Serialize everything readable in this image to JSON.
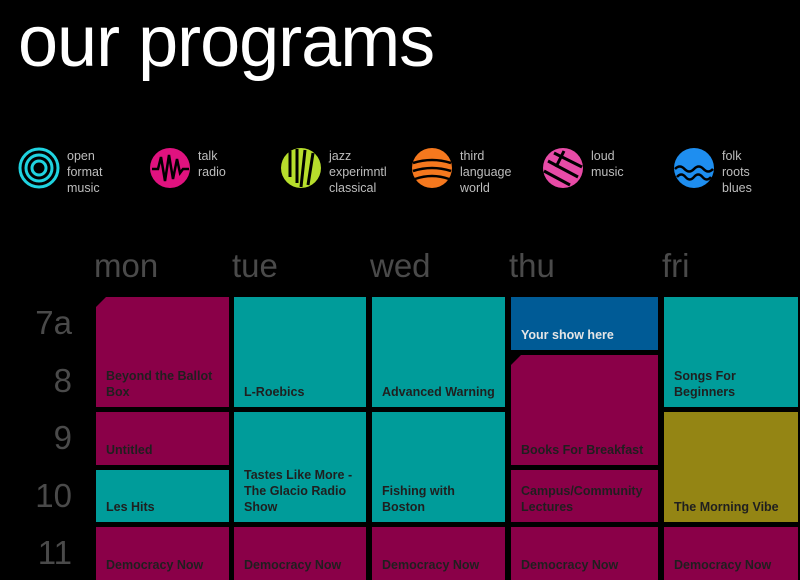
{
  "page": {
    "title": "our programs"
  },
  "legend": [
    {
      "icon": "target-icon",
      "color": "#1fd3e0",
      "lines": [
        "open",
        "format",
        "music"
      ]
    },
    {
      "icon": "waveform-icon",
      "color": "#e0127f",
      "lines": [
        "talk",
        "radio"
      ]
    },
    {
      "icon": "slashes-icon",
      "color": "#b7de2c",
      "lines": [
        "jazz",
        "experimntl",
        "classical"
      ]
    },
    {
      "icon": "curves-icon",
      "color": "#f5781e",
      "lines": [
        "third",
        "language",
        "world"
      ]
    },
    {
      "icon": "lines-icon",
      "color": "#e84ba7",
      "lines": [
        "loud",
        "music"
      ]
    },
    {
      "icon": "waves-icon",
      "color": "#1e8ef0",
      "lines": [
        "folk",
        "roots",
        "blues"
      ]
    }
  ],
  "days": [
    "mon",
    "tue",
    "wed",
    "thu",
    "fri"
  ],
  "hours": [
    "7a",
    "8",
    "9",
    "10",
    "11"
  ],
  "colors": {
    "talk": "#8a0048",
    "open": "#009c9a",
    "third": "#005b96",
    "folk": "#948514"
  },
  "schedule": {
    "mon": [
      {
        "title": "Beyond the Ballot Box",
        "genre": "talk",
        "start": 0,
        "span": 2
      },
      {
        "title": "Untitled",
        "genre": "talk",
        "start": 2,
        "span": 1
      },
      {
        "title": "Les Hits",
        "genre": "open",
        "start": 3,
        "span": 1
      },
      {
        "title": "Democracy Now",
        "genre": "talk",
        "start": 4,
        "span": 1
      }
    ],
    "tue": [
      {
        "title": "L-Roebics",
        "genre": "open",
        "start": 0,
        "span": 2
      },
      {
        "title": "Tastes Like More - The Glacio Radio Show",
        "genre": "open",
        "start": 2,
        "span": 2
      },
      {
        "title": "Democracy Now",
        "genre": "talk",
        "start": 4,
        "span": 1
      }
    ],
    "wed": [
      {
        "title": "Advanced Warning",
        "genre": "open",
        "start": 0,
        "span": 2
      },
      {
        "title": "Fishing with Boston",
        "genre": "open",
        "start": 2,
        "span": 2
      },
      {
        "title": "Democracy Now",
        "genre": "talk",
        "start": 4,
        "span": 1
      }
    ],
    "thu": [
      {
        "title": "Your show here",
        "genre": "third",
        "start": 0,
        "span": 1
      },
      {
        "title": "Books For Breakfast",
        "genre": "talk",
        "start": 1,
        "span": 2
      },
      {
        "title": "Campus/Community Lectures",
        "genre": "talk",
        "start": 3,
        "span": 1
      },
      {
        "title": "Democracy Now",
        "genre": "talk",
        "start": 4,
        "span": 1
      }
    ],
    "fri": [
      {
        "title": "Songs For Beginners",
        "genre": "open",
        "start": 0,
        "span": 2
      },
      {
        "title": "The Morning Vibe",
        "genre": "folk",
        "start": 2,
        "span": 2
      },
      {
        "title": "Democracy Now",
        "genre": "talk",
        "start": 4,
        "span": 1
      }
    ]
  }
}
